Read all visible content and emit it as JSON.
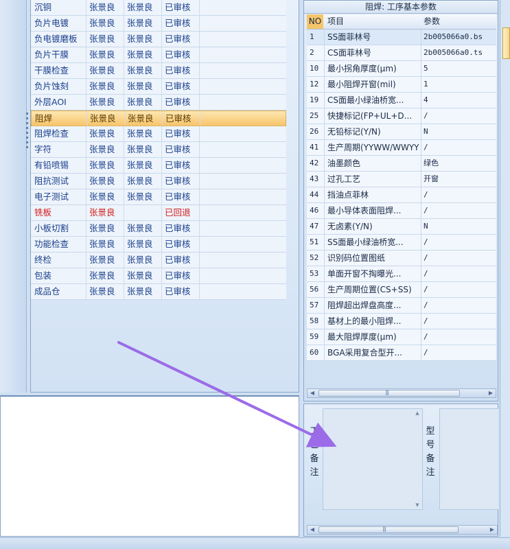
{
  "process_list": {
    "rows": [
      {
        "step": "沉铜",
        "operator": "张景良",
        "reviewer": "张景良",
        "status": "已审核",
        "state": "normal"
      },
      {
        "step": "负片电镀",
        "operator": "张景良",
        "reviewer": "张景良",
        "status": "已审核",
        "state": "normal"
      },
      {
        "step": "负电镀磨板",
        "operator": "张景良",
        "reviewer": "张景良",
        "status": "已审核",
        "state": "normal"
      },
      {
        "step": "负片干膜",
        "operator": "张景良",
        "reviewer": "张景良",
        "status": "已审核",
        "state": "normal"
      },
      {
        "step": "干膜检查",
        "operator": "张景良",
        "reviewer": "张景良",
        "status": "已审核",
        "state": "normal"
      },
      {
        "step": "负片蚀刻",
        "operator": "张景良",
        "reviewer": "张景良",
        "status": "已审核",
        "state": "normal"
      },
      {
        "step": "外层AOI",
        "operator": "张景良",
        "reviewer": "张景良",
        "status": "已审核",
        "state": "normal"
      },
      {
        "step": "阻焊",
        "operator": "张景良",
        "reviewer": "张景良",
        "status": "已审核",
        "state": "selected"
      },
      {
        "step": "阻焊检查",
        "operator": "张景良",
        "reviewer": "张景良",
        "status": "已审核",
        "state": "normal"
      },
      {
        "step": "字符",
        "operator": "张景良",
        "reviewer": "张景良",
        "status": "已审核",
        "state": "normal"
      },
      {
        "step": "有铅喷锡",
        "operator": "张景良",
        "reviewer": "张景良",
        "status": "已审核",
        "state": "normal"
      },
      {
        "step": "阻抗测试",
        "operator": "张景良",
        "reviewer": "张景良",
        "status": "已审核",
        "state": "normal"
      },
      {
        "step": "电子测试",
        "operator": "张景良",
        "reviewer": "张景良",
        "status": "已审核",
        "state": "normal"
      },
      {
        "step": "铣板",
        "operator": "张景良",
        "reviewer": "",
        "status": "已回退",
        "state": "rejected"
      },
      {
        "step": "小板切割",
        "operator": "张景良",
        "reviewer": "张景良",
        "status": "已审核",
        "state": "normal"
      },
      {
        "step": "功能检查",
        "operator": "张景良",
        "reviewer": "张景良",
        "status": "已审核",
        "state": "normal"
      },
      {
        "step": "终检",
        "operator": "张景良",
        "reviewer": "张景良",
        "status": "已审核",
        "state": "normal"
      },
      {
        "step": "包装",
        "operator": "张景良",
        "reviewer": "张景良",
        "status": "已审核",
        "state": "normal"
      },
      {
        "step": "成品仓",
        "operator": "张景良",
        "reviewer": "张景良",
        "status": "已审核",
        "state": "normal"
      }
    ]
  },
  "param_grid": {
    "title": "阻焊: 工序基本参数",
    "headers": {
      "no": "NO",
      "item": "项目",
      "param": "参数"
    },
    "rows": [
      {
        "no": "1",
        "item": "SS面菲林号",
        "value": "2b005066a0.bs"
      },
      {
        "no": "2",
        "item": "CS面菲林号",
        "value": "2b005066a0.ts"
      },
      {
        "no": "10",
        "item": "最小拐角厚度(μm)",
        "value": "5"
      },
      {
        "no": "12",
        "item": "最小阻焊开窗(mil)",
        "value": "1"
      },
      {
        "no": "19",
        "item": "CS面最小绿油桥宽...",
        "value": "4"
      },
      {
        "no": "25",
        "item": "快捷标记(FP+UL+D...",
        "value": "/"
      },
      {
        "no": "26",
        "item": "无铅标记(Y/N)",
        "value": "N"
      },
      {
        "no": "41",
        "item": "生产周期(YYWW/WWYY)",
        "value": "/"
      },
      {
        "no": "42",
        "item": "油墨颜色",
        "value": "绿色"
      },
      {
        "no": "43",
        "item": "过孔工艺",
        "value": "开窗"
      },
      {
        "no": "44",
        "item": "挡油点菲林",
        "value": "/"
      },
      {
        "no": "46",
        "item": "最小导体表面阻焊...",
        "value": "/"
      },
      {
        "no": "47",
        "item": "无卤素(Y/N)",
        "value": "N"
      },
      {
        "no": "51",
        "item": "SS面最小绿油桥宽...",
        "value": "/"
      },
      {
        "no": "52",
        "item": "识别码位置图纸",
        "value": "/"
      },
      {
        "no": "53",
        "item": "单面开窗不掏曝光...",
        "value": "/"
      },
      {
        "no": "56",
        "item": "生产周期位置(CS+SS)",
        "value": "/"
      },
      {
        "no": "57",
        "item": "阻焊超出焊盘高度...",
        "value": "/"
      },
      {
        "no": "58",
        "item": "基材上的最小阻焊...",
        "value": "/"
      },
      {
        "no": "59",
        "item": "最大阻焊厚度(μm)",
        "value": "/"
      },
      {
        "no": "60",
        "item": "BGA采用复合型开...",
        "value": "/"
      }
    ]
  },
  "remarks": {
    "process_label": "工艺备注",
    "model_label": "型号备注"
  },
  "colors": {
    "selected_row": "#f8c46c",
    "rejected_text": "#d21b1b",
    "annotation_arrow": "#9b6be8"
  },
  "icons": {
    "scroll_left": "◀",
    "scroll_right": "▶",
    "scroll_up": "▲",
    "scroll_down": "▼",
    "grip": "|||"
  }
}
